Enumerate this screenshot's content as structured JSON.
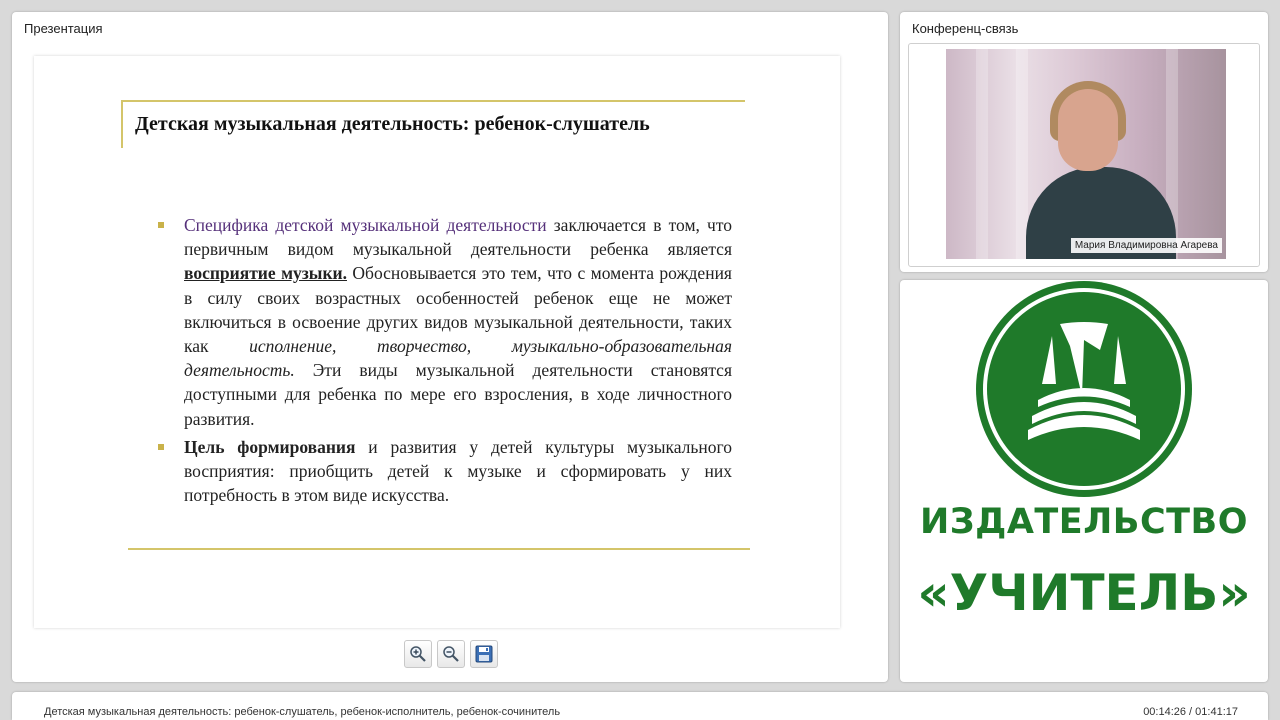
{
  "presentation": {
    "panel_title": "Презентация",
    "slide": {
      "title": "Детская музыкальная деятельность: ребенок-слушатель",
      "p1": {
        "lead": "Специфика детской музыкальной деятельности",
        "t1": " заключается в том, что первичным видом музыкальной деятельности ребенка является ",
        "emph": "восприятие музыки.",
        "t2": " Обосновывается это тем, что с момента рождения в силу своих возрастных особенностей ребенок еще не может включиться в освоение других видов музыкальной деятельности, таких как ",
        "ital": "исполнение, творчество, музыкально-образовательная деятельность.",
        "t3": " Эти виды музыкальной деятельности становятся доступными для ребенка по мере его взросления, в ходе личностного развития."
      },
      "p2": {
        "lead": "Цель формирования",
        "t1": " и развития у детей культуры музыкального восприятия: приобщить детей к музыке и сформировать у них потребность в этом виде искусства."
      }
    },
    "toolbar": {
      "zoom_in_icon": "zoom-in-icon",
      "zoom_out_icon": "zoom-out-icon",
      "save_icon": "floppy-disk-icon"
    }
  },
  "conference": {
    "panel_title": "Конференц-связь",
    "speaker_name": "Мария Владимировна Агарева"
  },
  "logo": {
    "line1": "ИЗДАТЕЛЬСТВО",
    "line2": "«УЧИТЕЛЬ»",
    "brand_color": "#1f7a2a"
  },
  "footer": {
    "lecture_title": "Детская музыкальная деятельность: ребенок-слушатель, ребенок-исполнитель, ребенок-сочинитель",
    "time": "00:14:26 / 01:41:17"
  }
}
